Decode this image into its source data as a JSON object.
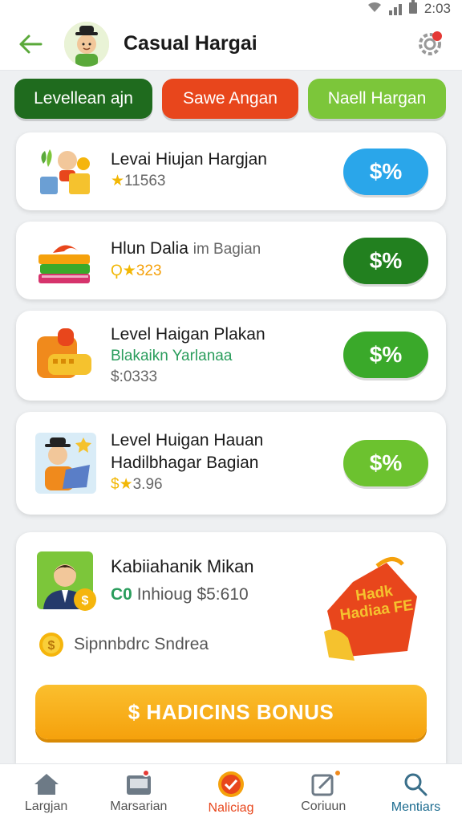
{
  "status": {
    "time": "2:03"
  },
  "header": {
    "title": "Casual Hargai"
  },
  "chips": [
    {
      "label": "Levellean ajn",
      "color": "#1f6b1e"
    },
    {
      "label": "Sawe Angan",
      "color": "#e8461c"
    },
    {
      "label": "Naell Hargan",
      "color": "#7cc63a"
    }
  ],
  "cards": [
    {
      "name": "Levai Hiujan Hargjan",
      "price": "11563",
      "price_prefix": "★",
      "badge": "$%",
      "badge_color": "#2aa6ea"
    },
    {
      "name": "Hlun Dalia",
      "name_extra": "im Bagian",
      "price": "323",
      "price_prefix": "Ϙ★",
      "badge": "$%",
      "badge_color": "#22801f"
    },
    {
      "name": "Level Haigan Plakan",
      "sub": "Blakaikn Yarlanaa",
      "price": "0333",
      "price_prefix": "$:",
      "badge": "$%",
      "badge_color": "#3aa92a"
    },
    {
      "name": "Level Huigan Hauan",
      "name2": "Hadilbhagar Bagian",
      "price": "3.96",
      "price_prefix": "$★",
      "badge": "$%",
      "badge_color": "#6cc22f"
    }
  ],
  "promo": {
    "name": "Kabiiahanik Mikan",
    "coin_prefix": "C0",
    "detail": "Inhioug",
    "amount": "$5:610",
    "note": "Sipnnbdrc Sndrea",
    "tag_text": "Hadk Hadiaa FE",
    "button": "$ HADICINS BONUS"
  },
  "nav": [
    {
      "label": "Largjan",
      "icon": "home-icon"
    },
    {
      "label": "Marsarian",
      "icon": "inbox-icon",
      "badge": true
    },
    {
      "label": "Naliciag",
      "icon": "check-badge-icon",
      "active": true
    },
    {
      "label": "Coriuun",
      "icon": "edit-icon",
      "badge": true
    },
    {
      "label": "Mentiars",
      "icon": "search-icon"
    }
  ],
  "colors": {
    "accent": "#e8461c",
    "green_dark": "#1f6b1e",
    "green_light": "#7cc63a",
    "orange": "#f5a10c"
  }
}
